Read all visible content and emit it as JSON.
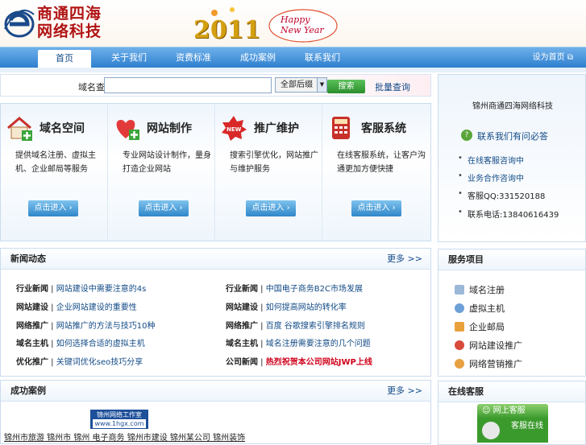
{
  "header": {
    "logo_line1": "商通四海",
    "logo_line2": "网络科技",
    "banner_year": "2011",
    "banner_text_1": "Happy",
    "banner_text_2": "New Year"
  },
  "nav": {
    "items": [
      {
        "label": "首页"
      },
      {
        "label": "关于我们"
      },
      {
        "label": "资费标准"
      },
      {
        "label": "成功案例"
      },
      {
        "label": "联系我们"
      }
    ],
    "right": "设为首页"
  },
  "search": {
    "label": "域名查询：",
    "placeholder": "",
    "select_value": "全部后缀",
    "button": "搜索",
    "advanced": "批量查询"
  },
  "services": [
    {
      "title": "域名空间",
      "desc": "提供域名注册、虚拟主机、企业邮局等服务",
      "button": "点击进入"
    },
    {
      "title": "网站制作",
      "desc": "专业网站设计制作，量身打造企业网站",
      "button": "点击进入"
    },
    {
      "title": "推广维护",
      "desc": "搜索引擎优化，网站推广与维护服务",
      "button": "点击进入"
    },
    {
      "title": "客服系统",
      "desc": "在线客服系统，让客户沟通更加方便快捷",
      "button": "点击进入"
    }
  ],
  "contact": {
    "heading": "锦州商通四海网络科技",
    "question": "联系我们有问必答",
    "items": [
      "在线客服咨询中",
      "业务合作咨询中",
      "客服QQ:331520188",
      "联系电话:13840616439"
    ]
  },
  "news": {
    "title": "新闻动态",
    "more": "更多 >>",
    "items": [
      {
        "cat": "行业新闻",
        "title": "网站建设中需要注意的4s"
      },
      {
        "cat": "行业新闻",
        "title": "中国电子商务B2C市场发展"
      },
      {
        "cat": "网站建设",
        "title": "企业网站建设的重要性"
      },
      {
        "cat": "网站建设",
        "title": "如何提高网站的转化率"
      },
      {
        "cat": "网络推广",
        "title": "网站推广的方法与技巧10种"
      },
      {
        "cat": "网络推广",
        "title": "百度 谷歌搜索引擎排名规则"
      },
      {
        "cat": "域名主机",
        "title": "如何选择合适的虚拟主机"
      },
      {
        "cat": "域名主机",
        "title": "域名注册需要注意的几个问题"
      },
      {
        "cat": "优化推广",
        "title": "关键词优化seo技巧分享"
      },
      {
        "cat": "公司新闻",
        "title": "热烈祝贺本公司网站JWP上线",
        "red": true
      }
    ]
  },
  "services_list": {
    "title": "服务项目",
    "items": [
      "域名注册",
      "虚拟主机",
      "企业邮局",
      "网站建设推广",
      "网络营销推广"
    ]
  },
  "cases": {
    "title": "成功案例",
    "more": "更多 >>",
    "logo_text_1": "锦州网络工作室",
    "logo_text_2": "www.1hgx.com",
    "links": "锦州市旅游  锦州市 锦州 电子商务  锦州市建设  锦州某公司 锦州装饰"
  },
  "kefu": {
    "title": "在线客服",
    "banner": "网上客服",
    "status": "客服在线"
  },
  "colors": {
    "nav": "#2d7fcf",
    "brand_red": "#b01414",
    "link": "#124a86"
  }
}
